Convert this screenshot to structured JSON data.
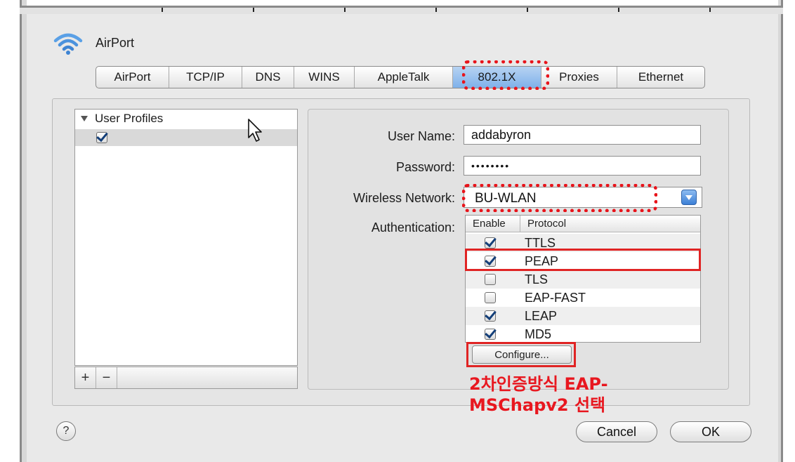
{
  "window": {
    "title": "AirPort"
  },
  "tabs": [
    {
      "label": "AirPort"
    },
    {
      "label": "TCP/IP"
    },
    {
      "label": "DNS"
    },
    {
      "label": "WINS"
    },
    {
      "label": "AppleTalk"
    },
    {
      "label": "802.1X",
      "active": true
    },
    {
      "label": "Proxies"
    },
    {
      "label": "Ethernet"
    }
  ],
  "profiles": {
    "header": "User Profiles",
    "rows": [
      {
        "checked": true
      }
    ],
    "add_label": "+",
    "remove_label": "−"
  },
  "form": {
    "user_name_label": "User Name:",
    "user_name_value": "addabyron",
    "password_label": "Password:",
    "password_value": "••••••••",
    "wireless_label": "Wireless Network:",
    "wireless_value": "BU-WLAN",
    "auth_label": "Authentication:"
  },
  "protocols": {
    "col_enable": "Enable",
    "col_protocol": "Protocol",
    "rows": [
      {
        "name": "TTLS",
        "enabled": true
      },
      {
        "name": "PEAP",
        "enabled": true
      },
      {
        "name": "TLS",
        "enabled": false
      },
      {
        "name": "EAP-FAST",
        "enabled": false
      },
      {
        "name": "LEAP",
        "enabled": true
      },
      {
        "name": "MD5",
        "enabled": true
      }
    ],
    "configure_label": "Configure..."
  },
  "annotation": {
    "line1": "2차인증방식 EAP-",
    "line2": "MSChapv2 선택"
  },
  "footer": {
    "help_label": "?",
    "cancel_label": "Cancel",
    "ok_label": "OK"
  },
  "colors": {
    "highlight_red": "#e02424",
    "active_tab": "#7fb1ea"
  },
  "icons": {
    "title_icon": "wifi-icon",
    "pointer": "cursor-arrow-icon"
  }
}
